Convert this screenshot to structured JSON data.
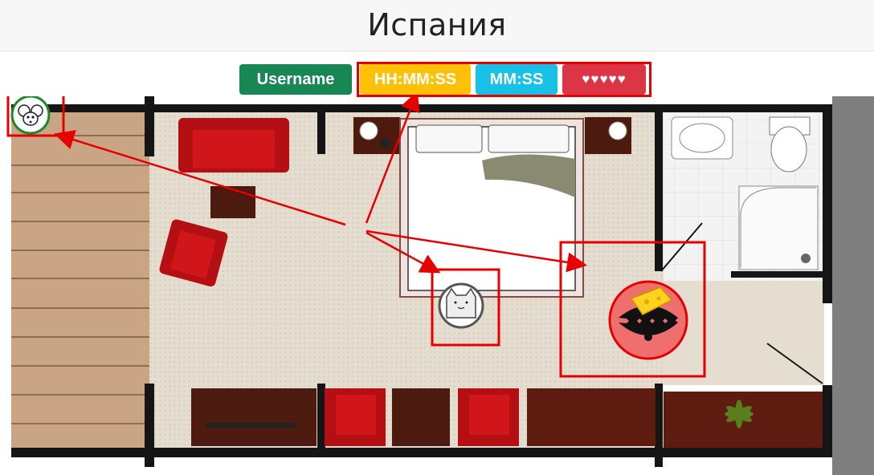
{
  "header": {
    "title": "Испания"
  },
  "hud": {
    "username": "Username",
    "clock": "HH:MM:SS",
    "timer": "MM:SS",
    "lives": "♥♥♥♥♥"
  },
  "colors": {
    "username_badge": "#198754",
    "clock_badge": "#ffc107",
    "timer_badge": "#17c2e6",
    "lives_badge": "#dc3545",
    "highlight": "#e60000"
  },
  "icons": [
    "mouse-icon",
    "cat-icon",
    "trap-with-cheese-icon"
  ]
}
